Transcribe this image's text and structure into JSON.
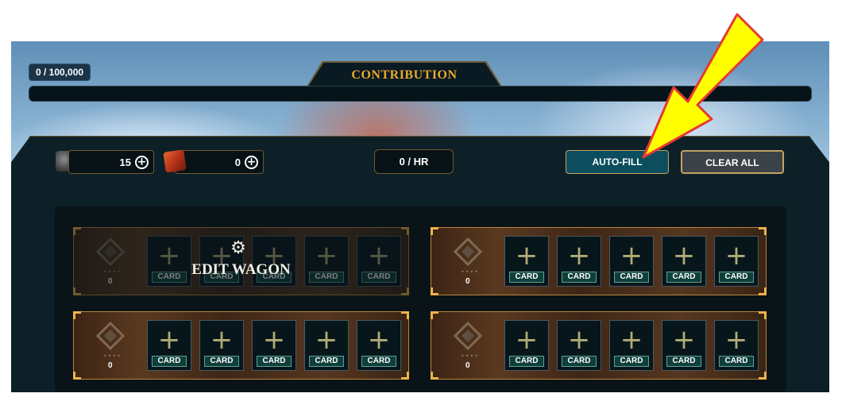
{
  "contribution": {
    "title": "CONTRIBUTION",
    "progress_text": "0 / 100,000",
    "progress_fraction": 0
  },
  "resources": [
    {
      "icon": "treasure-chest-icon",
      "value": "15"
    },
    {
      "icon": "red-crate-icon",
      "value": "0"
    }
  ],
  "rate": {
    "text": "0 / HR"
  },
  "buttons": {
    "autofill": "AUTO-FILL",
    "clear_all": "CLEAR ALL"
  },
  "wagons": [
    {
      "count": "0",
      "editable_overlay": true,
      "slots": [
        "CARD",
        "CARD",
        "CARD",
        "CARD",
        "CARD"
      ]
    },
    {
      "count": "0",
      "editable_overlay": false,
      "slots": [
        "CARD",
        "CARD",
        "CARD",
        "CARD",
        "CARD"
      ]
    },
    {
      "count": "0",
      "editable_overlay": false,
      "slots": [
        "CARD",
        "CARD",
        "CARD",
        "CARD",
        "CARD"
      ]
    },
    {
      "count": "0",
      "editable_overlay": false,
      "slots": [
        "CARD",
        "CARD",
        "CARD",
        "CARD",
        "CARD"
      ]
    }
  ],
  "edit_wagon": {
    "label": "EDIT WAGON",
    "icon": "gear-icon"
  },
  "annotation": {
    "icon": "yellow-arrow-icon",
    "color": "#ffff00",
    "target": "auto-fill-button"
  },
  "colors": {
    "accent_gold": "#e8a92b",
    "frame": "#b8873e",
    "teal_button": "#0d4e5e"
  }
}
